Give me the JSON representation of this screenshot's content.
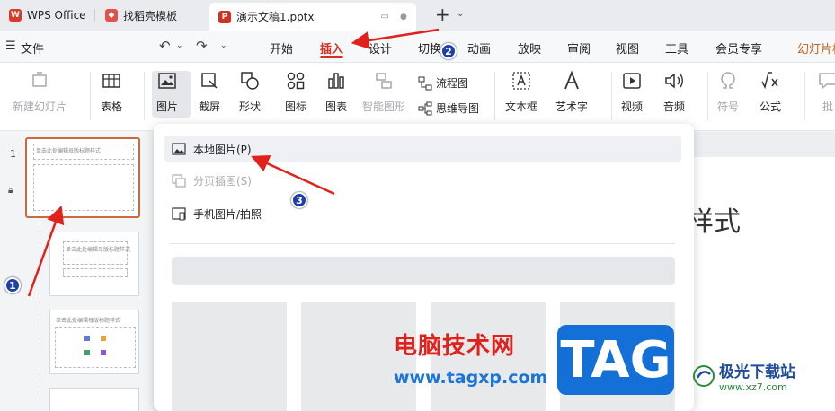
{
  "titlebar": {
    "tabs": [
      {
        "label": "WPS Office"
      },
      {
        "label": "找稻壳模板"
      },
      {
        "label": "演示文稿1.pptx"
      }
    ],
    "new_tab": "+"
  },
  "menubar": {
    "file": "文件",
    "items": [
      "开始",
      "插入",
      "设计",
      "切换",
      "动画",
      "放映",
      "审阅",
      "视图",
      "工具",
      "会员专享",
      "幻灯片核"
    ]
  },
  "ribbon": {
    "new_slide": "新建幻灯片",
    "table": "表格",
    "picture": "图片",
    "screenshot": "截屏",
    "shape": "形状",
    "icon": "图标",
    "chart": "图表",
    "smart_graphic": "智能图形",
    "flowchart": "流程图",
    "mindmap": "思维导图",
    "textbox": "文本框",
    "wordart": "艺术字",
    "video": "视频",
    "audio": "音频",
    "symbol": "符号",
    "formula": "公式",
    "comment": "批"
  },
  "slides": {
    "numbers": [
      "1"
    ],
    "thumb1_title": "单击此处编辑母版标题样式",
    "thumb2_title": "单击此处编辑母版标题样式",
    "thumb3_title": "单击此处编辑母版标题样式"
  },
  "canvas": {
    "title_fragment": "样式"
  },
  "dropdown": {
    "local_picture": "本地图片(P)",
    "paged_picture": "分页插图(S)",
    "phone_picture": "手机图片/拍照"
  },
  "annotations": {
    "n1": "1",
    "n2": "2",
    "n3": "3"
  },
  "watermark": {
    "cn": "电脑技术网",
    "url": "www.tagxp.com",
    "tag": "TAG",
    "jg_name": "极光下载站",
    "jg_url": "www.xz7.com"
  },
  "colors": {
    "accent": "#d2321f",
    "arrow": "#e0211c",
    "badge": "#1f3fa8"
  }
}
